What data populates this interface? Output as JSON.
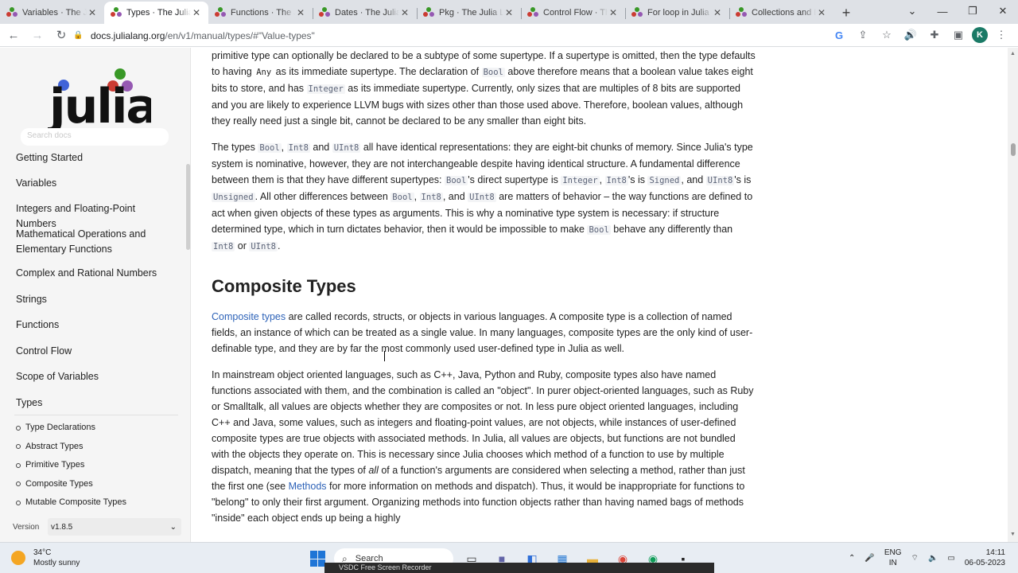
{
  "browser": {
    "tabs": [
      {
        "title": "Variables · The Julia"
      },
      {
        "title": "Types · The Julia L"
      },
      {
        "title": "Functions · The Ju"
      },
      {
        "title": "Dates · The Julia L"
      },
      {
        "title": "Pkg · The Julia La"
      },
      {
        "title": "Control Flow · Th"
      },
      {
        "title": "For loop in Julia"
      },
      {
        "title": "Collections and D"
      }
    ],
    "url_host": "docs.julialang.org",
    "url_path": "/en/v1/manual/types/#\"Value-types\"",
    "profile_initial": "K"
  },
  "sidebar": {
    "logo_text": "julia",
    "search_placeholder": "Search docs",
    "items": [
      "Getting Started",
      "Variables",
      "Integers and Floating-Point Numbers",
      "Mathematical Operations and Elementary Functions",
      "Complex and Rational Numbers",
      "Strings",
      "Functions",
      "Control Flow",
      "Scope of Variables",
      "Types"
    ],
    "subitems": [
      "Type Declarations",
      "Abstract Types",
      "Primitive Types",
      "Composite Types",
      "Mutable Composite Types"
    ],
    "version_label": "Version",
    "version_value": "v1.8.5"
  },
  "article": {
    "p1": {
      "a": "primitive type can optionally be declared to be a subtype of some supertype. If a supertype is omitted, then the type defaults to having ",
      "c1": "Any",
      "b": " as its immediate supertype. The declaration of ",
      "c2": "Bool",
      "c": " above therefore means that a boolean value takes eight bits to store, and has ",
      "c3": "Integer",
      "d": " as its immediate supertype. Currently, only sizes that are multiples of 8 bits are supported and you are likely to experience LLVM bugs with sizes other than those used above. Therefore, boolean values, although they really need just a single bit, cannot be declared to be any smaller than eight bits."
    },
    "p2": {
      "a": "The types ",
      "c1": "Bool",
      "b": ", ",
      "c2": "Int8",
      "c": " and ",
      "c3": "UInt8",
      "d": " all have identical representations: they are eight-bit chunks of memory. Since Julia's type system is nominative, however, they are not interchangeable despite having identical structure. A fundamental difference between them is that they have different supertypes: ",
      "c4": "Bool",
      "e": "'s direct supertype is ",
      "c5": "Integer",
      "f": ", ",
      "c6": "Int8",
      "g": "'s is ",
      "c7": "Signed",
      "h": ", and ",
      "c8": "UInt8",
      "i": "'s is ",
      "c9": "Unsigned",
      "j": ". All other differences between ",
      "c10": "Bool",
      "k": ", ",
      "c11": "Int8",
      "l": ", and ",
      "c12": "UInt8",
      "m": " are matters of behavior – the way functions are defined to act when given objects of these types as arguments. This is why a nominative type system is necessary: if structure determined type, which in turn dictates behavior, then it would be impossible to make ",
      "c13": "Bool",
      "n": " behave any differently than ",
      "c14": "Int8",
      "o": " or ",
      "c15": "UInt8",
      "p": "."
    },
    "heading": "Composite Types",
    "p3": {
      "link": "Composite types",
      "a": " are called records, structs, or objects in various languages. A composite type is a collection of named fields, an instance of which can be treated as a single value. In many languages, composite types are the only kind of user-definable type, and they are by far the most commonly used user-defined type in Julia as well."
    },
    "p4": {
      "a": "In mainstream object oriented languages, such as C++, Java, Python and Ruby, composite types also have named functions associated with them, and the combination is called an \"object\". In purer object-oriented languages, such as Ruby or Smalltalk, all values are objects whether they are composites or not. In less pure object oriented languages, including C++ and Java, some values, such as integers and floating-point values, are not objects, while instances of user-defined composite types are true objects with associated methods. In Julia, all values are objects, but functions are not bundled with the objects they operate on. This is necessary since Julia chooses which method of a function to use by multiple dispatch, meaning that the types of ",
      "em": "all",
      "b": " of a function's arguments are considered when selecting a method, rather than just the first one (see ",
      "link": "Methods",
      "c": " for more information on methods and dispatch). Thus, it would be inappropriate for functions to \"belong\" to only their first argument. Organizing methods into function objects rather than having named bags of methods \"inside\" each object ends up being a highly"
    }
  },
  "taskbar": {
    "temp": "34°C",
    "weather": "Mostly sunny",
    "search_label": "Search",
    "lang1": "ENG",
    "lang2": "IN",
    "time": "14:11",
    "date": "06-05-2023",
    "recorder_label": "VSDC Free Screen Recorder"
  },
  "colors": {
    "link": "#2e63b8",
    "julia_red": "#cb3c33",
    "julia_green": "#389826",
    "julia_purple": "#9558b2",
    "julia_blue": "#4063d8"
  }
}
